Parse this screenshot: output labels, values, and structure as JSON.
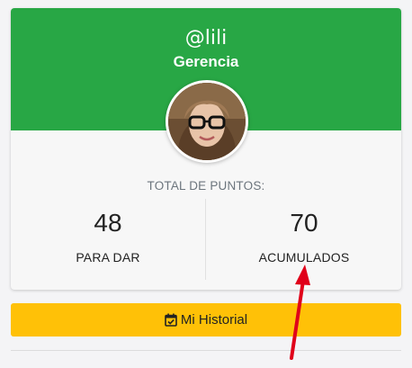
{
  "profile": {
    "username": "@lili",
    "role": "Gerencia",
    "avatar_icon": "user-avatar-photo"
  },
  "points": {
    "total_label": "TOTAL DE PUNTOS:",
    "to_give": {
      "value": "48",
      "label": "PARA DAR"
    },
    "accumulated": {
      "value": "70",
      "label": "ACUMULADOS"
    }
  },
  "actions": {
    "history_label": "Mi Historial",
    "history_icon": "calendar-check-icon"
  },
  "colors": {
    "header_green": "#28a745",
    "button_yellow": "#ffc107",
    "annotation_arrow": "#e0001a"
  }
}
